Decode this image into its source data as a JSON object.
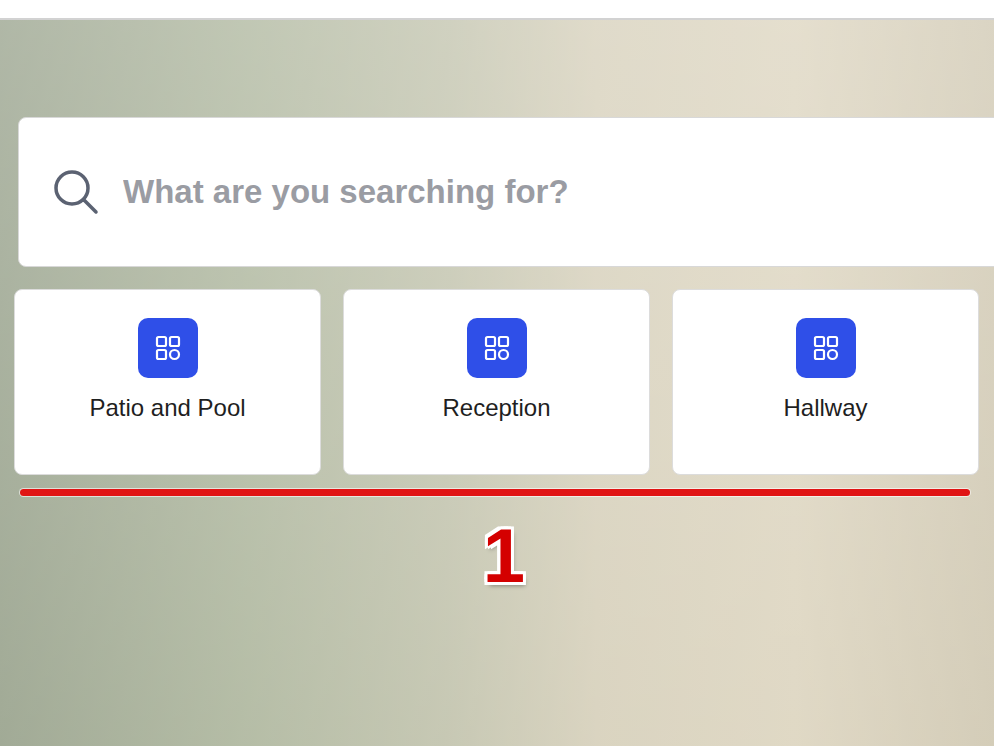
{
  "search": {
    "placeholder": "What are you searching for?"
  },
  "categories": [
    {
      "label": "Patio and Pool"
    },
    {
      "label": "Reception"
    },
    {
      "label": "Hallway"
    }
  ],
  "annotation": {
    "label": "1"
  }
}
